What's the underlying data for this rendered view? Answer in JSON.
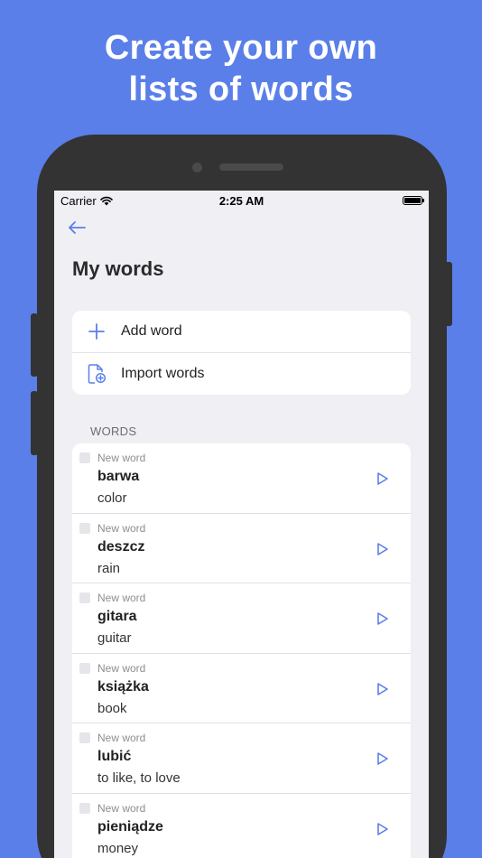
{
  "headline": {
    "line1": "Create your own",
    "line2": "lists of words"
  },
  "status_bar": {
    "carrier": "Carrier",
    "time": "2:25 AM"
  },
  "page": {
    "title": "My words"
  },
  "actions": [
    {
      "label": "Add word",
      "icon": "plus-icon"
    },
    {
      "label": "Import words",
      "icon": "import-file-icon"
    }
  ],
  "section": {
    "label": "WORDS"
  },
  "words": [
    {
      "status": "New word",
      "term": "barwa",
      "translation": "color"
    },
    {
      "status": "New word",
      "term": "deszcz",
      "translation": "rain"
    },
    {
      "status": "New word",
      "term": "gitara",
      "translation": "guitar"
    },
    {
      "status": "New word",
      "term": "książka",
      "translation": "book"
    },
    {
      "status": "New word",
      "term": "lubić",
      "translation": "to like, to love"
    },
    {
      "status": "New word",
      "term": "pieniądze",
      "translation": "money"
    }
  ],
  "colors": {
    "background": "#5b7fe9",
    "accent": "#5b7fe9",
    "phone_frame": "#333333",
    "screen_bg": "#efeff4"
  }
}
